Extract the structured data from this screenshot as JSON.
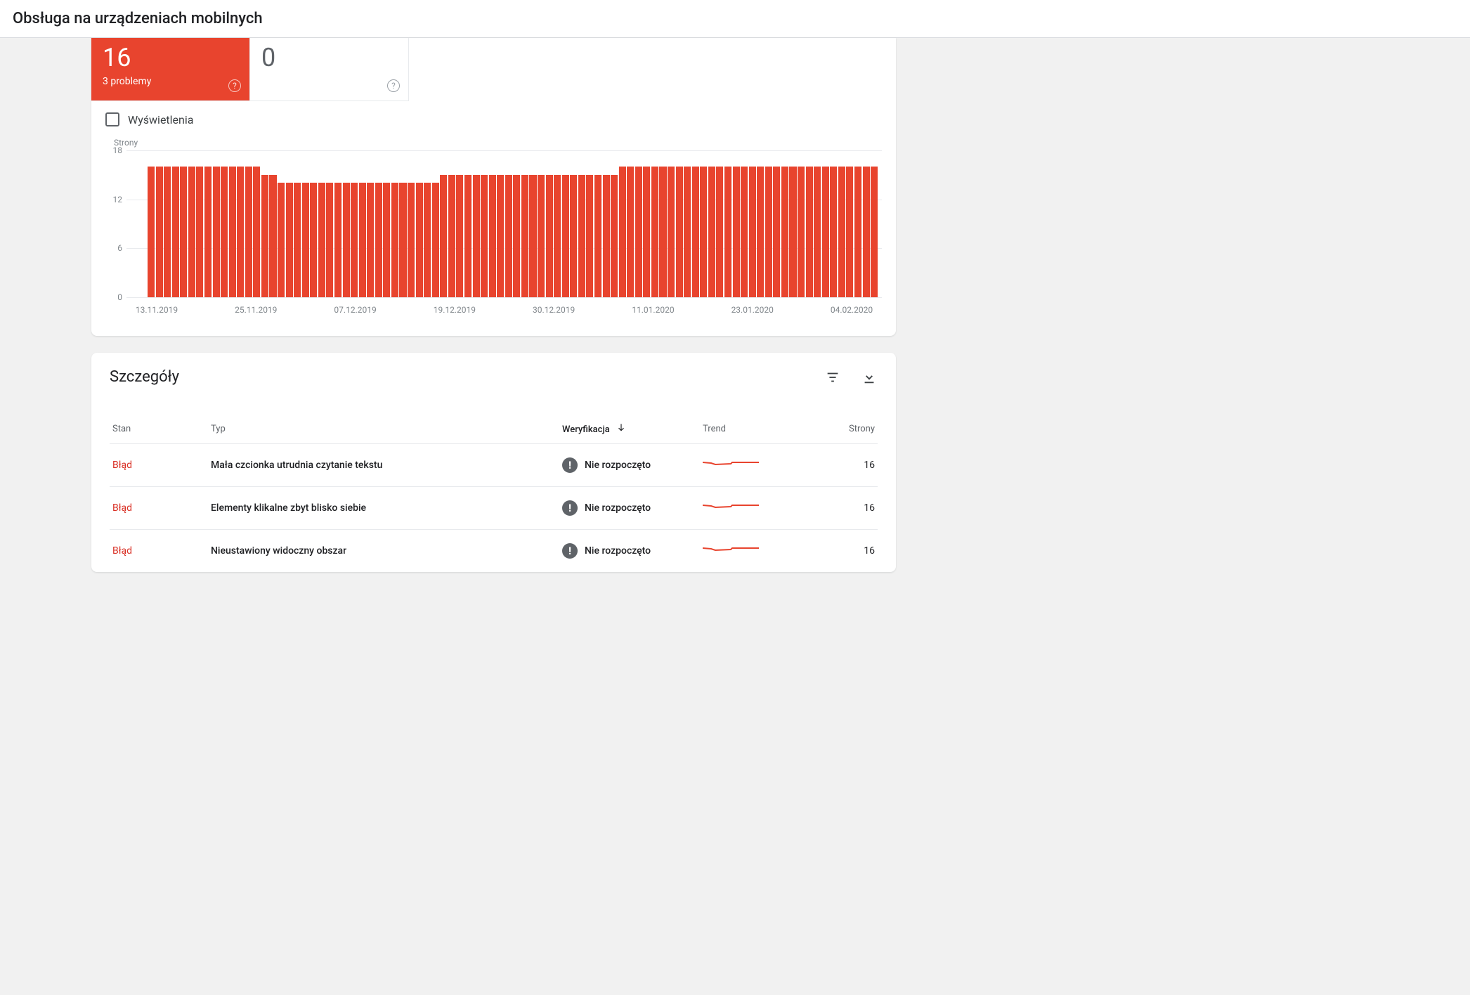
{
  "header": {
    "title": "Obsługa na urządzeniach mobilnych"
  },
  "tabs": {
    "error": {
      "value": "16",
      "sub": "3 problemy"
    },
    "valid": {
      "value": "0"
    }
  },
  "toggle": {
    "label": "Wyświetlenia"
  },
  "chart_data": {
    "type": "bar",
    "title": "",
    "xlabel": "",
    "ylabel": "Strony",
    "ylim": [
      0,
      18
    ],
    "yticks": [
      0,
      6,
      12,
      18
    ],
    "xticks": [
      "13.11.2019",
      "25.11.2019",
      "07.12.2019",
      "19.12.2019",
      "30.12.2019",
      "11.01.2020",
      "23.01.2020",
      "04.02.2020"
    ],
    "values": [
      16,
      16,
      16,
      16,
      16,
      16,
      16,
      16,
      16,
      16,
      16,
      16,
      16,
      16,
      15,
      15,
      14,
      14,
      14,
      14,
      14,
      14,
      14,
      14,
      14,
      14,
      14,
      14,
      14,
      14,
      14,
      14,
      14,
      14,
      14,
      14,
      15,
      15,
      15,
      15,
      15,
      15,
      15,
      15,
      15,
      15,
      15,
      15,
      15,
      15,
      15,
      15,
      15,
      15,
      15,
      15,
      15,
      15,
      16,
      16,
      16,
      16,
      16,
      16,
      16,
      16,
      16,
      16,
      16,
      16,
      16,
      16,
      16,
      16,
      16,
      16,
      16,
      16,
      16,
      16,
      16,
      16,
      16,
      16,
      16,
      16,
      16,
      16,
      16,
      16
    ]
  },
  "details": {
    "title": "Szczegóły",
    "columns": {
      "status": "Stan",
      "type": "Typ",
      "verification": "Weryfikacja",
      "trend": "Trend",
      "pages": "Strony"
    },
    "rows": [
      {
        "status": "Błąd",
        "type": "Mała czcionka utrudnia czytanie tekstu",
        "verification": "Nie rozpoczęto",
        "pages": "16"
      },
      {
        "status": "Błąd",
        "type": "Elementy klikalne zbyt blisko siebie",
        "verification": "Nie rozpoczęto",
        "pages": "16"
      },
      {
        "status": "Błąd",
        "type": "Nieustawiony widoczny obszar",
        "verification": "Nie rozpoczęto",
        "pages": "16"
      }
    ]
  }
}
